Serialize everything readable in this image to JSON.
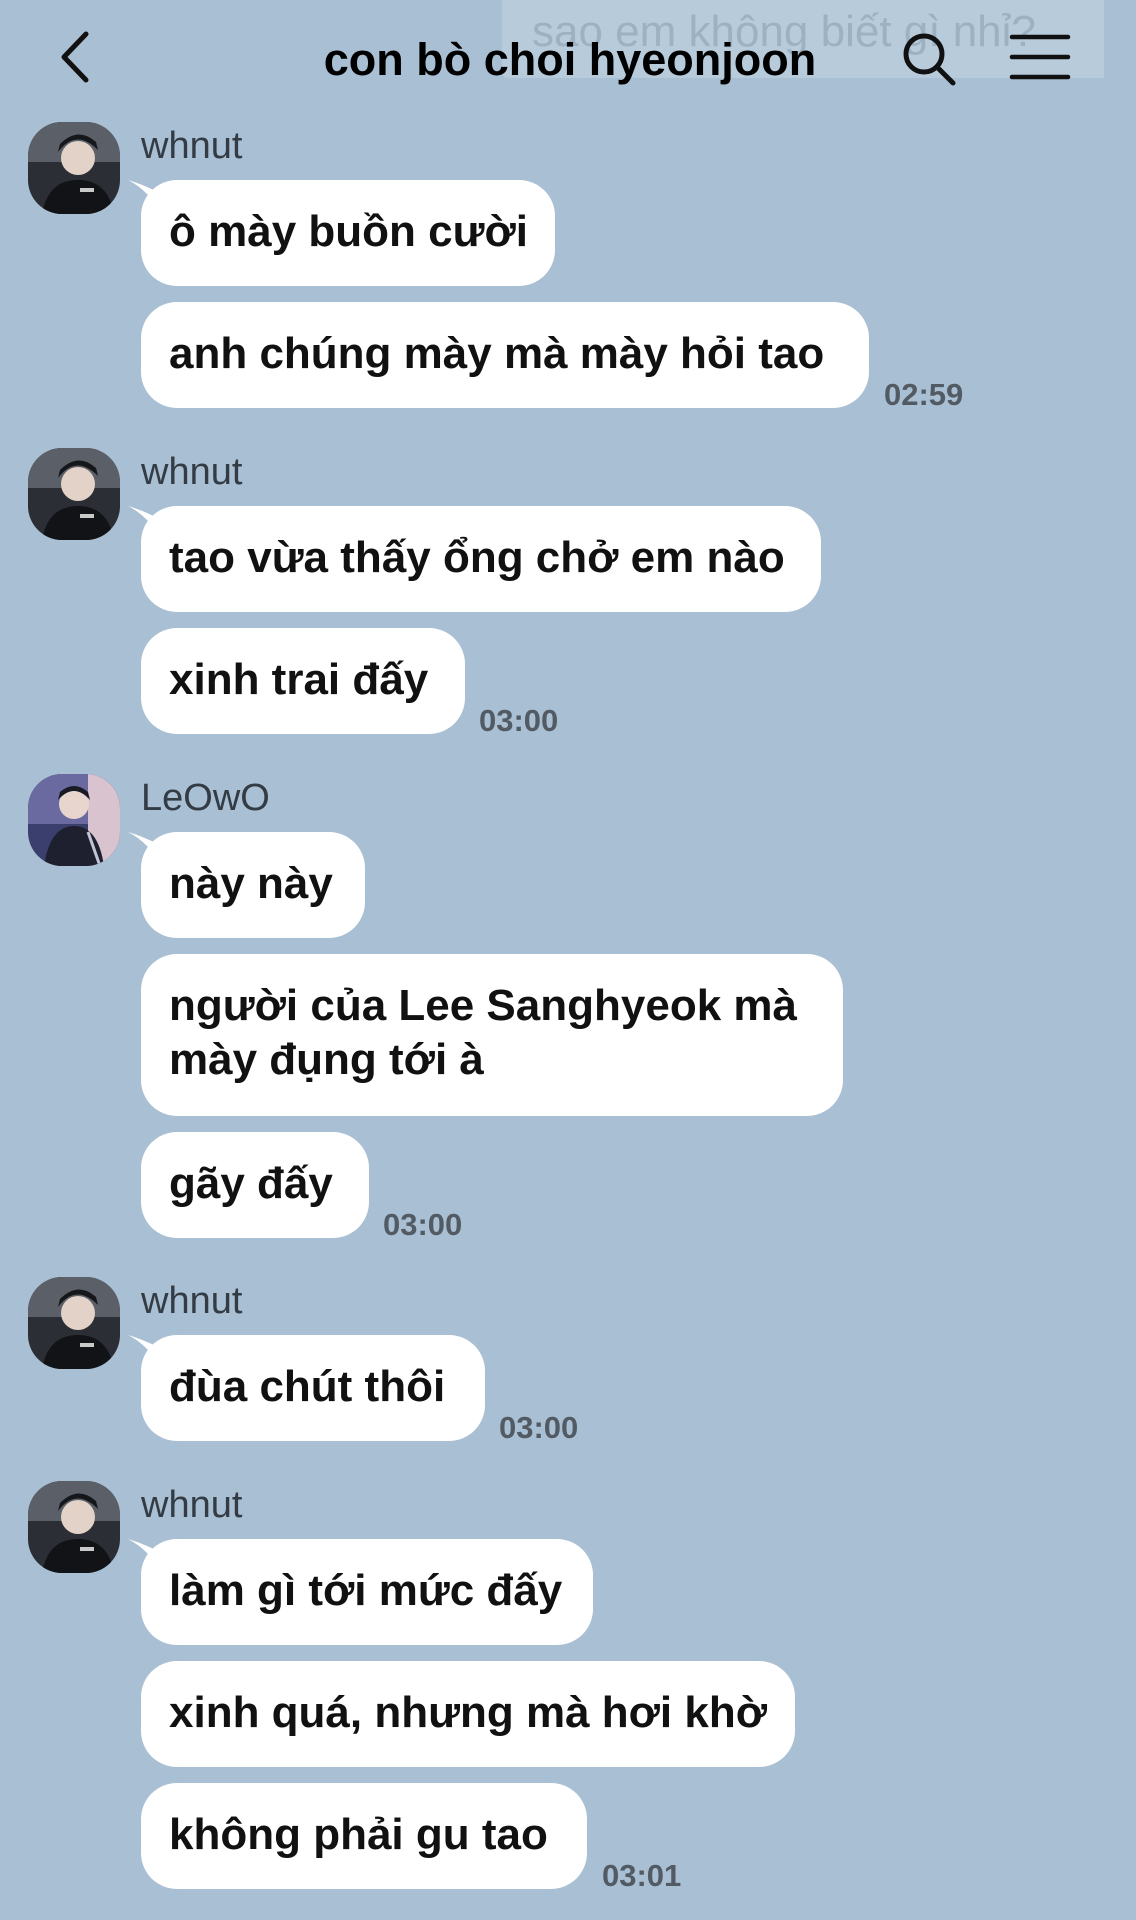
{
  "ghost_text": "sao em không biết gì nhỉ?",
  "header": {
    "back_icon": "chevron-left-icon",
    "title": "con bò choi hyeonjoon",
    "search_icon": "search-icon",
    "menu_icon": "hamburger-menu-icon"
  },
  "groups": [
    {
      "sender": "whnut",
      "messages": [
        "ô mày buồn cười",
        "anh chúng mày mà mày hỏi tao"
      ],
      "time": "02:59"
    },
    {
      "sender": "whnut",
      "messages": [
        "tao vừa thấy ổng chở em nào",
        "xinh trai đấy"
      ],
      "time": "03:00"
    },
    {
      "sender": "LeOwO",
      "messages": [
        "này này",
        "người của Lee Sanghyeok mà mày đụng tới à",
        "gãy đấy"
      ],
      "time": "03:00"
    },
    {
      "sender": "whnut",
      "messages": [
        "đùa chút thôi"
      ],
      "time": "03:00"
    },
    {
      "sender": "whnut",
      "messages": [
        "làm gì tới mức đấy",
        "xinh quá, nhưng mà hơi khờ",
        "không phải gu tao"
      ],
      "time": "03:01"
    }
  ]
}
